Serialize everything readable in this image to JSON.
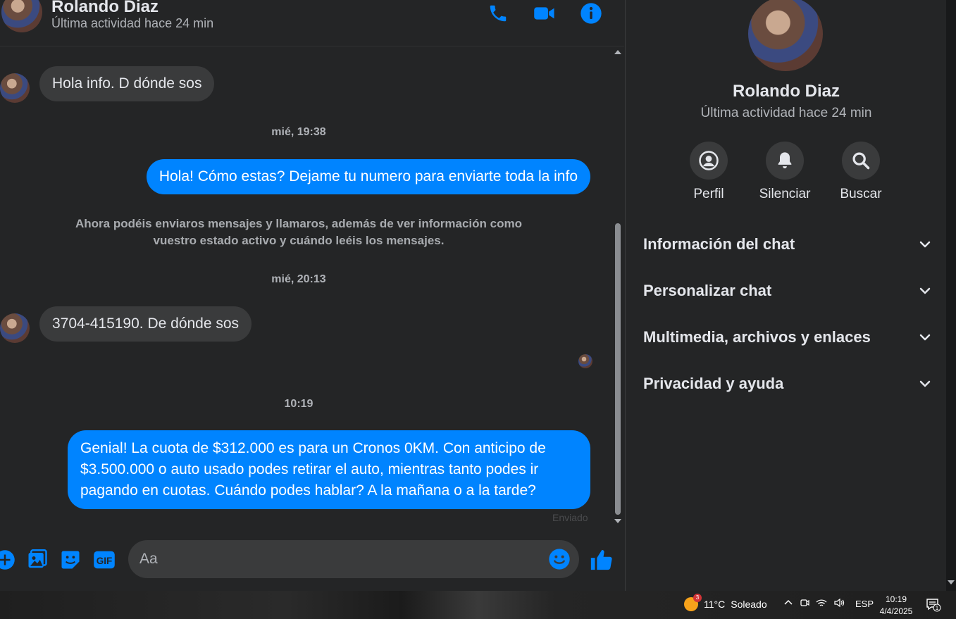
{
  "header": {
    "name": "Rolando Diaz",
    "status": "Última actividad hace 24 min",
    "icons": [
      "phone-icon",
      "video-icon",
      "info-icon"
    ]
  },
  "messages": {
    "m1": "Hola info. D dónde sos",
    "ts1": "mié, 19:38",
    "m2": "Hola! Cómo estas? Dejame tu numero para enviarte toda la info",
    "notice": "Ahora podéis enviaros mensajes y llamaros, además de ver información como vuestro estado activo y cuándo leéis los mensajes.",
    "ts2": "mié, 20:13",
    "m3": "3704-415190. De dónde sos",
    "ts3": "10:19",
    "m4": "Genial! La cuota de $312.000 es para un Cronos 0KM. Con anticipo de $3.500.000 o auto usado podes retirar el auto, mientras tanto podes ir pagando en cuotas. Cuándo podes hablar? A la mañana o a la tarde?",
    "sent_label": "Enviado"
  },
  "composer": {
    "placeholder": "Aa",
    "icons": [
      "plus-icon",
      "photo-icon",
      "sticker-icon",
      "gif-icon",
      "emoji-icon",
      "like-icon"
    ],
    "gif_label": "GIF"
  },
  "info": {
    "name": "Rolando Diaz",
    "status": "Última actividad hace 24 min",
    "actions": [
      {
        "label": "Perfil",
        "icon": "profile-icon"
      },
      {
        "label": "Silenciar",
        "icon": "bell-icon"
      },
      {
        "label": "Buscar",
        "icon": "search-icon"
      }
    ],
    "sections": [
      "Información del chat",
      "Personalizar chat",
      "Multimedia, archivos y enlaces",
      "Privacidad y ayuda"
    ]
  },
  "taskbar": {
    "weather_temp": "11°C",
    "weather_text": "Soleado",
    "weather_badge": "3",
    "language": "ESP",
    "time": "10:19",
    "date": "4/4/2025",
    "notif_count": "1"
  },
  "colors": {
    "accent": "#0084ff",
    "background": "#242526",
    "bubble_in": "#3a3b3c"
  }
}
